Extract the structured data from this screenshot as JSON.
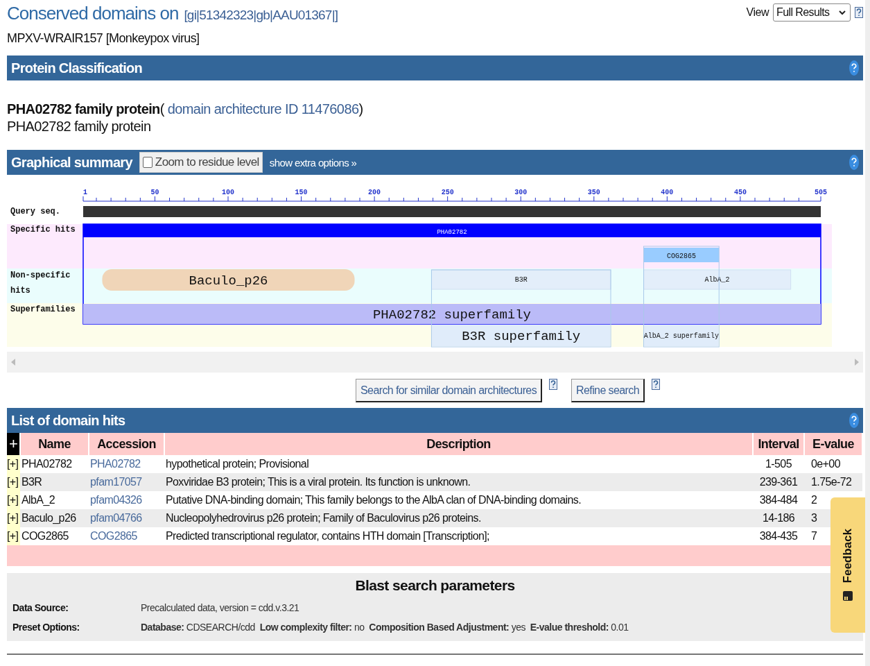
{
  "header": {
    "title": "Conserved domains on",
    "query_id": "[gi|51342323|gb|AAU01367|]",
    "subtitle": "MPXV-WRAIR157 [Monkeypox virus]",
    "view_label": "View",
    "view_value": "Full Results"
  },
  "protein_classification": {
    "title": "Protein Classification",
    "name": "PHA02782 family protein",
    "open": "(",
    "link": "domain architecture ID 11476086",
    "close": ")",
    "description": "PHA02782 family protein"
  },
  "graphical_summary": {
    "title": "Graphical summary",
    "zoom_checkbox": {
      "label": "Zoom to residue level",
      "checked": false
    },
    "extra_options": "show extra options »",
    "ticks": [
      "1",
      "50",
      "100",
      "150",
      "200",
      "250",
      "300",
      "350",
      "400",
      "450",
      "505"
    ],
    "tracks": [
      "Query seq.",
      "Specific hits",
      "Non-specific hits",
      "Superfamilies"
    ],
    "hits": [
      {
        "label": "PHA02782",
        "kind": "specific",
        "color": "#0000ff"
      },
      {
        "label": "COG2865",
        "kind": "specific",
        "color": "#99ccff"
      },
      {
        "label": "Baculo_p26",
        "kind": "nonspecific",
        "color": "#f0d5b8"
      },
      {
        "label": "B3R",
        "kind": "nonspecific",
        "color": "#e3eefa"
      },
      {
        "label": "AlbA_2",
        "kind": "nonspecific",
        "color": "#e3eefa"
      },
      {
        "label": "PHA02782 superfamily",
        "kind": "superfamily",
        "color": "#bbbbf8"
      },
      {
        "label": "B3R superfamily",
        "kind": "superfamily",
        "color": "#e0ecfa"
      },
      {
        "label": "AlbA_2 superfamily",
        "kind": "superfamily",
        "color": "#e0ecfa"
      }
    ]
  },
  "buttons": [
    "Search for similar domain architectures",
    "Refine search"
  ],
  "domain_hits": {
    "title": "List of domain hits",
    "columns": [
      "+",
      "Name",
      "Accession",
      "Description",
      "Interval",
      "E-value"
    ],
    "rows": [
      {
        "expander": "[+]",
        "name": "PHA02782",
        "accession": "PHA02782",
        "description": "hypothetical protein; Provisional",
        "interval": "1-505",
        "evalue": "0e+00"
      },
      {
        "expander": "[+]",
        "name": "B3R",
        "accession": "pfam17057",
        "description": "Poxviridae B3 protein; This is a viral protein. Its function is unknown.",
        "interval": "239-361",
        "evalue": "1.75e-72"
      },
      {
        "expander": "[+]",
        "name": "AlbA_2",
        "accession": "pfam04326",
        "description": "Putative DNA-binding domain; This family belongs to the AlbA clan of DNA-binding domains.",
        "interval": "384-484",
        "evalue": "2"
      },
      {
        "expander": "[+]",
        "name": "Baculo_p26",
        "accession": "pfam04766",
        "description": "Nucleopolyhedrovirus p26 protein; Family of Baculovirus p26 proteins.",
        "interval": "14-186",
        "evalue": "3"
      },
      {
        "expander": "[+]",
        "name": "COG2865",
        "accession": "COG2865",
        "description": "Predicted transcriptional regulator, contains HTH domain [Transcription];",
        "interval": "384-435",
        "evalue": "7"
      }
    ]
  },
  "blast_parameters": {
    "title": "Blast search parameters",
    "rows": [
      {
        "label": "Data Source:",
        "value": "Precalculated data, version = cdd.v.3.21"
      },
      {
        "label": "Preset Options:",
        "value": "**Database:** CDSEARCH/cdd  **Low complexity filter:** no  **Composition Based Adjustment:** yes  **E-value threshold:** 0.01"
      }
    ]
  },
  "feedback": {
    "label": "Feedback"
  }
}
